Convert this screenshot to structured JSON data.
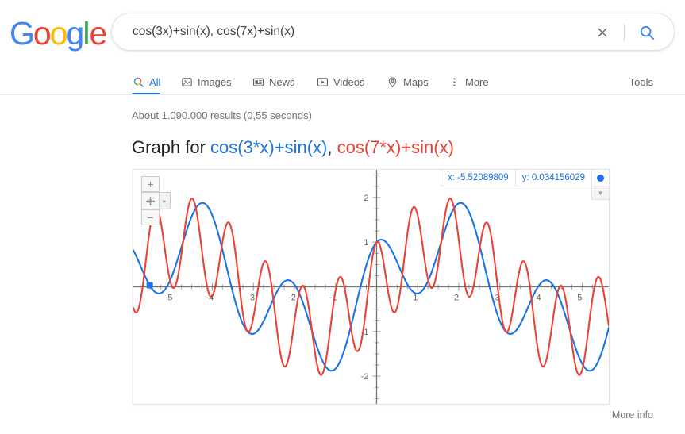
{
  "brand": {
    "name": "Google",
    "letters": [
      {
        "ch": "G",
        "color": "#4285F4"
      },
      {
        "ch": "o",
        "color": "#EA4335"
      },
      {
        "ch": "o",
        "color": "#FBBC05"
      },
      {
        "ch": "g",
        "color": "#4285F4"
      },
      {
        "ch": "l",
        "color": "#34A853"
      },
      {
        "ch": "e",
        "color": "#EA4335"
      }
    ]
  },
  "search": {
    "query": "cos(3x)+sin(x), cos(7x)+sin(x)",
    "placeholder": "Search",
    "clear_icon": "close-icon",
    "submit_icon": "search-icon"
  },
  "nav": {
    "tabs": [
      {
        "label": "All",
        "icon": "search-icon",
        "active": true
      },
      {
        "label": "Images",
        "icon": "image-icon",
        "active": false
      },
      {
        "label": "News",
        "icon": "news-icon",
        "active": false
      },
      {
        "label": "Videos",
        "icon": "video-icon",
        "active": false
      },
      {
        "label": "Maps",
        "icon": "map-pin-icon",
        "active": false
      },
      {
        "label": "More",
        "icon": "more-vertical-icon",
        "active": false
      }
    ],
    "tools_label": "Tools"
  },
  "results": {
    "stats": "About 1.090.000 results (0,55 seconds)"
  },
  "graph": {
    "title_prefix": "Graph for ",
    "function_1": "cos(3*x)+sin(x)",
    "function_2": "cos(7*x)+sin(x)",
    "function_1_color": "#1a73e8",
    "function_2_color": "#ea4335",
    "readout": {
      "x_label": "x: -5.52089809",
      "y_label": "y: 0.034156029",
      "marker_icon": "blue-dot-icon",
      "expand_icon": "chevron-down-icon"
    },
    "controls": {
      "zoom_in_label": "+",
      "zoom_out_label": "−",
      "pan_icon": "pan-move-icon",
      "expand_icon": "chevron-right-icon"
    },
    "more_info_label": "More info"
  },
  "chart_data": {
    "type": "line",
    "title": "Graph for cos(3*x)+sin(x), cos(7*x)+sin(x)",
    "xlabel": "x",
    "ylabel": "y",
    "xlim": [
      -5.92,
      5.65
    ],
    "ylim": [
      -2.62,
      2.62
    ],
    "xticks": [
      -5,
      -4,
      -3,
      -2,
      -1,
      1,
      2,
      3,
      4,
      5
    ],
    "yticks": [
      2,
      1,
      -1,
      -2
    ],
    "minor_tick_step": 0.25,
    "grid": false,
    "legend": "none",
    "series": [
      {
        "name": "cos(3*x)+sin(x)",
        "color": "#1a73e8",
        "expression": "cos(3*x)+sin(x)",
        "amplitude_range": [
          -2.0,
          2.0
        ]
      },
      {
        "name": "cos(7*x)+sin(x)",
        "color": "#ea4335",
        "expression": "cos(7*x)+sin(x)",
        "amplitude_range": [
          -2.0,
          2.0
        ]
      }
    ],
    "marker": {
      "x": -5.52089809,
      "y": 0.034156029,
      "series": "cos(3*x)+sin(x)",
      "color": "#1a73e8"
    }
  }
}
